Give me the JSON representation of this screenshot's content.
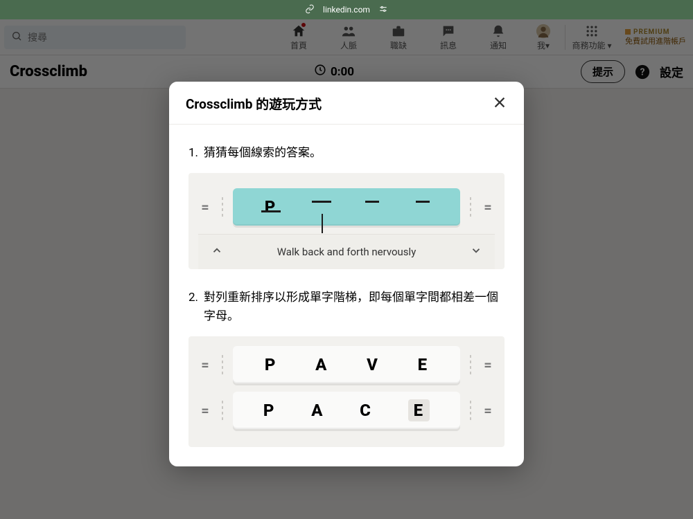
{
  "browser": {
    "url": "linkedin.com"
  },
  "search": {
    "placeholder": "搜尋"
  },
  "nav": {
    "home": "首頁",
    "network": "人脈",
    "jobs": "職缺",
    "messages": "訊息",
    "notifications": "通知",
    "me": "我",
    "business": "商務功能",
    "premium_tag": "PREMIUM",
    "premium_text": "免費試用進階帳戶"
  },
  "game": {
    "title": "Crossclimb",
    "timer": "0:00",
    "hint": "提示",
    "settings": "設定"
  },
  "modal": {
    "title": "Crossclimb 的遊玩方式",
    "step1_num": "1.",
    "step1_text": "猜猜每個線索的答案。",
    "step1_letter": "P",
    "step1_clue": "Walk back and forth nervously",
    "step2_num": "2.",
    "step2_text": "對列重新排序以形成單字階梯，即每個單字間都相差一個字母。",
    "word1": {
      "a": "P",
      "b": "A",
      "c": "V",
      "d": "E"
    },
    "word2": {
      "a": "P",
      "b": "A",
      "c": "C",
      "d": "E"
    }
  }
}
